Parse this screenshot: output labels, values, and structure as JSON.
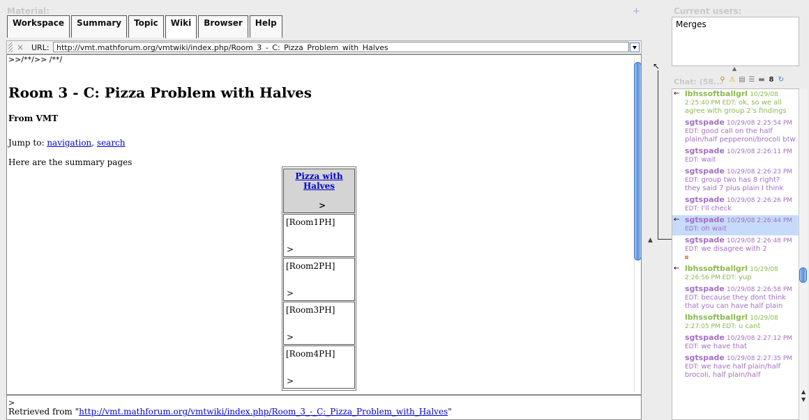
{
  "material": {
    "label": "Material:",
    "add": "+"
  },
  "tabs": [
    {
      "label": "Workspace",
      "active": false
    },
    {
      "label": "Summary",
      "active": false
    },
    {
      "label": "Topic",
      "active": false
    },
    {
      "label": "Wiki",
      "active": true
    },
    {
      "label": "Browser",
      "active": false
    },
    {
      "label": "Help",
      "active": false
    }
  ],
  "urlbar": {
    "close": "×",
    "label": "URL:",
    "value": "http://vmt.mathforum.org/vmtwiki/index.php/Room_3_-_C:_Pizza_Problem_with_Halves"
  },
  "page": {
    "comment": ">>/**/>> /**/",
    "title": "Room 3 - C: Pizza Problem with Halves",
    "from": "From VMT",
    "jump_prefix": "Jump to: ",
    "jump_nav": "navigation",
    "jump_sep": ", ",
    "jump_search": "search",
    "summary": "Here are the summary pages",
    "table": {
      "header": "Pizza with Halves",
      "header_gt": ">",
      "rows": [
        {
          "name": "[Room1PH]",
          "gt": ">"
        },
        {
          "name": "[Room2PH]",
          "gt": ">"
        },
        {
          "name": "[Room3PH]",
          "gt": ">"
        },
        {
          "name": "[Room4PH]",
          "gt": ">"
        }
      ]
    },
    "footer_gt": ">",
    "retrieved_prefix": "Retrieved from \"",
    "retrieved_link": "http://vmt.mathforum.org/vmtwiki/index.php/Room_3_-_C:_Pizza_Problem_with_Halves",
    "retrieved_suffix": "\""
  },
  "users": {
    "label": "Current users:",
    "list": [
      "Merges"
    ]
  },
  "chat": {
    "label": "Chat: (58...",
    "messages": [
      {
        "sender": "lbhssoftballgrl",
        "time": "10/29/08 2:25:40 PM EDT:",
        "text": "ok, so we all agree with group 2's findings",
        "color": "green",
        "arrow": "←",
        "highlight": false
      },
      {
        "sender": "sgtspade",
        "time": "10/29/08 2:25:54 PM EDT:",
        "text": "good call on the half plain/half pepperoni/brocoli btw",
        "color": "purple",
        "arrow": "",
        "highlight": false
      },
      {
        "sender": "sgtspade",
        "time": "10/29/08 2:26:11 PM EDT:",
        "text": "wait",
        "color": "purple",
        "arrow": "",
        "highlight": false
      },
      {
        "sender": "sgtspade",
        "time": "10/29/08 2:26:23 PM EDT:",
        "text": "group two has 8 right? they said 7 plus plain I think",
        "color": "purple",
        "arrow": "",
        "highlight": false
      },
      {
        "sender": "sgtspade",
        "time": "10/29/08 2:26:26 PM EDT:",
        "text": "I'll check",
        "color": "purple",
        "arrow": "",
        "highlight": false
      },
      {
        "sender": "sgtspade",
        "time": "10/29/08 2:26:44 PM EDT:",
        "text": "oh wait",
        "color": "purple",
        "arrow": "←",
        "highlight": true
      },
      {
        "sender": "sgtspade",
        "time": "10/29/08 2:26:48 PM EDT:",
        "text": "we disagree with 2",
        "color": "purple",
        "arrow": "",
        "highlight": false,
        "square": true
      },
      {
        "sender": "lbhssoftballgrl",
        "time": "10/29/08 2:26:56 PM EDT:",
        "text": "yup",
        "color": "green",
        "arrow": "←",
        "highlight": false
      },
      {
        "sender": "sgtspade",
        "time": "10/29/08 2:26:58 PM EDT:",
        "text": "because they dont think that you can have half plain",
        "color": "purple",
        "arrow": "",
        "highlight": false
      },
      {
        "sender": "lbhssoftballgrl",
        "time": "10/29/08 2:27:05 PM EDT:",
        "text": "u cant",
        "color": "green",
        "arrow": "",
        "highlight": false
      },
      {
        "sender": "sgtspade",
        "time": "10/29/08 2:27:12 PM EDT:",
        "text": "we have that",
        "color": "purple",
        "arrow": "",
        "highlight": false
      },
      {
        "sender": "sgtspade",
        "time": "10/29/08 2:27:35 PM EDT:",
        "text": "we have half plain/half brocoli, half plain/half",
        "color": "purple",
        "arrow": "",
        "highlight": false
      }
    ]
  },
  "icons": [
    "search-icon",
    "warning-icon",
    "list-icon",
    "indent-icon",
    "window-icon",
    "person-icon",
    "refresh-icon"
  ],
  "colors": {
    "chat_purple": "#a46fc4",
    "chat_green": "#8cb94e",
    "highlight": "#c6dbfa",
    "link": "#0000cc"
  }
}
